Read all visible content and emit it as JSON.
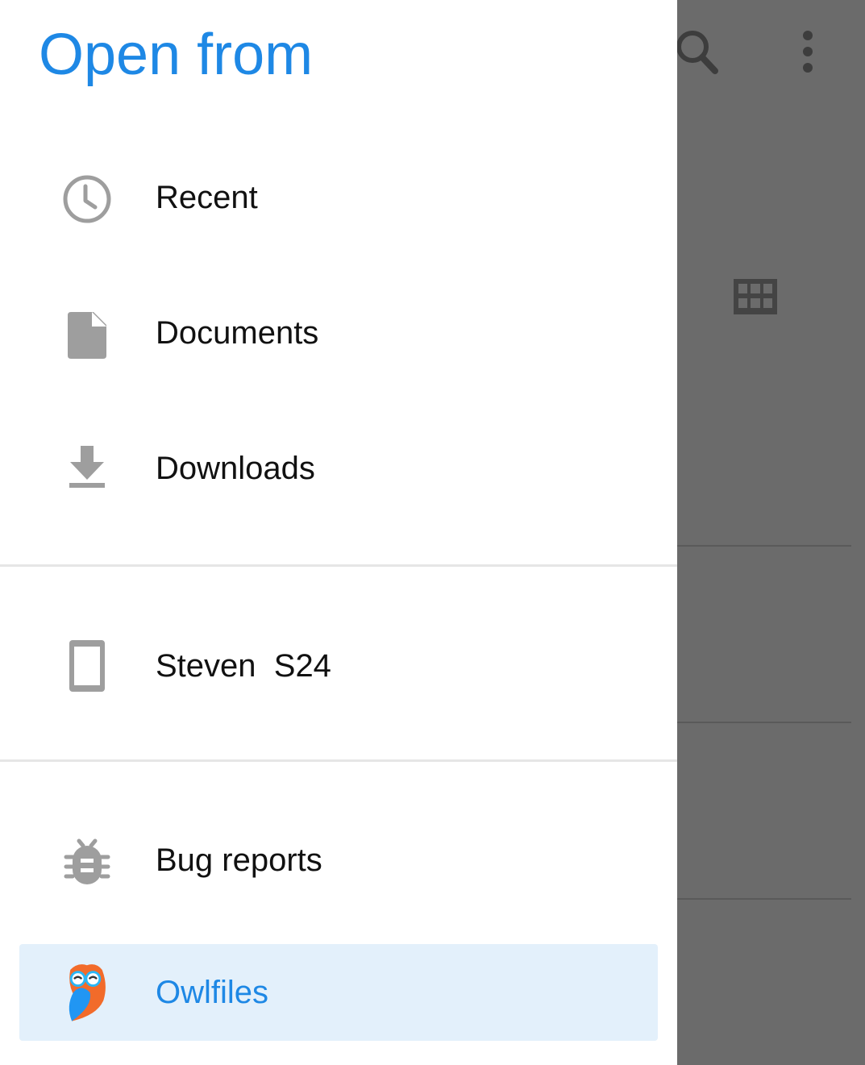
{
  "drawer": {
    "title": "Open from",
    "roots": [
      {
        "label": "Recent",
        "icon": "clock-icon"
      },
      {
        "label": "Documents",
        "icon": "document-icon"
      },
      {
        "label": "Downloads",
        "icon": "download-icon"
      },
      {
        "label": "Steven  S24",
        "icon": "phone-icon"
      },
      {
        "label": "Bug reports",
        "icon": "bug-icon"
      },
      {
        "label": "Owlfiles",
        "icon": "owl-icon",
        "selected": true
      }
    ]
  },
  "background_toolbar": {
    "icons": [
      "search-icon",
      "more-vert-icon",
      "grid-view-icon"
    ]
  },
  "colors": {
    "accent": "#1e88e5",
    "selected_bg": "#e3f0fb",
    "icon_gray": "#9e9e9e",
    "scrim": "#6b6b6b"
  }
}
